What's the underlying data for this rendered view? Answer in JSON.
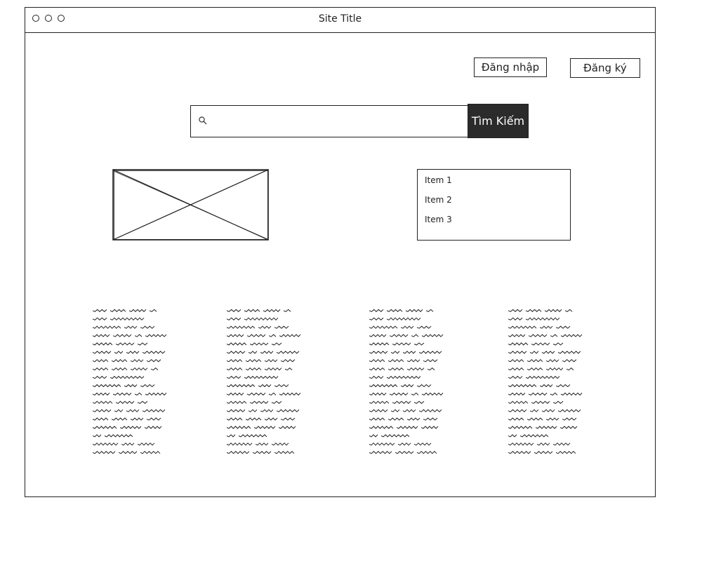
{
  "window": {
    "title": "Site Title"
  },
  "header": {
    "login_label": "Đăng nhập",
    "register_label": "Đăng ký"
  },
  "search": {
    "value": "",
    "placeholder": "",
    "button_label": "Tìm Kiếm"
  },
  "media": {
    "icon": "image-placeholder-icon"
  },
  "list": {
    "items": [
      {
        "label": "Item 1"
      },
      {
        "label": "Item 2"
      },
      {
        "label": "Item 3"
      }
    ]
  },
  "text_columns": {
    "count": 4,
    "content": "scribble-text"
  }
}
